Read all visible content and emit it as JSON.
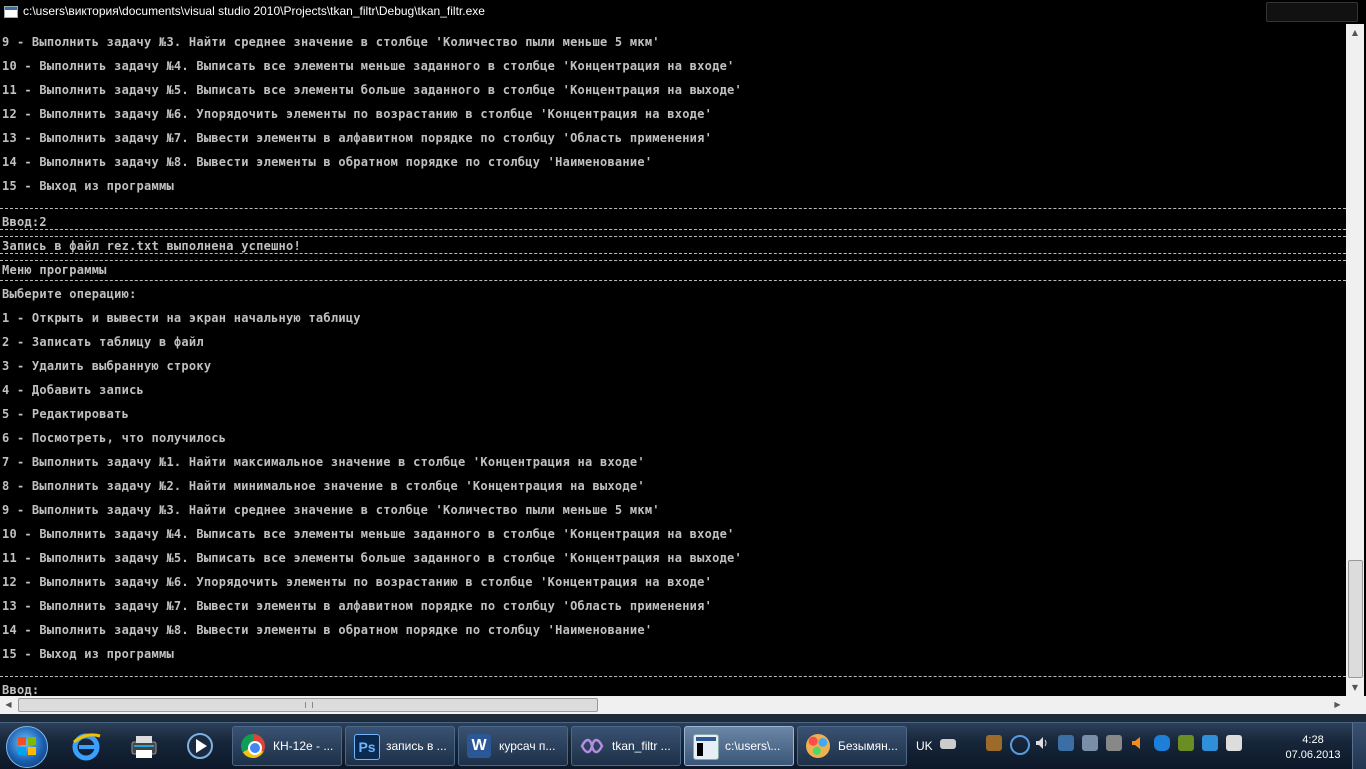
{
  "window": {
    "title": "c:\\users\\виктория\\documents\\visual studio 2010\\Projects\\tkan_filtr\\Debug\\tkan_filtr.exe"
  },
  "console": {
    "lines_top": [
      "9 - Выполнить задачу №3. Найти среднее значение в столбце 'Количество пыли меньше 5 мкм'",
      "10 - Выполнить задачу №4. Выписать все элементы меньше заданного в столбце 'Концентрация на входе'",
      "11 - Выполнить задачу №5. Выписать все элементы больше заданного в столбце 'Концентрация на выходе'",
      "12 - Выполнить задачу №6. Упорядочить элементы по возрастанию в столбце 'Концентрация на входе'",
      "13 - Выполнить задачу №7. Вывести элементы в алфавитном порядке по столбцу 'Область применения'",
      "14 - Выполнить задачу №8. Вывести элементы в обратном порядке по столбцу 'Наименование'",
      "15 - Выход из программы"
    ],
    "input_line": "Ввод:2",
    "success_line": "Запись в файл rez.txt выполнена успешно!",
    "menu_title": "Меню программы",
    "choose_op": "Выберите операцию:",
    "menu_items": [
      "1 - Открыть и вывести на экран начальную таблицу",
      "2 - Записать таблицу в файл",
      "3 - Удалить выбранную строку",
      "4 - Добавить запись",
      "5 - Редактировать",
      "6 - Посмотреть, что получилось",
      "7 - Выполнить задачу №1. Найти максимальное значение в столбце 'Концентрация на входе'",
      "8 - Выполнить задачу №2. Найти минимальное значение в столбце 'Концентрация на выходе'",
      "9 - Выполнить задачу №3. Найти среднее значение в столбце 'Количество пыли меньше 5 мкм'",
      "10 - Выполнить задачу №4. Выписать все элементы меньше заданного в столбце 'Концентрация на входе'",
      "11 - Выполнить задачу №5. Выписать все элементы больше заданного в столбце 'Концентрация на выходе'",
      "12 - Выполнить задачу №6. Упорядочить элементы по возрастанию в столбце 'Концентрация на входе'",
      "13 - Выполнить задачу №7. Вывести элементы в алфавитном порядке по столбцу 'Область применения'",
      "14 - Выполнить задачу №8. Вывести элементы в обратном порядке по столбцу 'Наименование'",
      "15 - Выход из программы"
    ],
    "prompt": "Ввод:"
  },
  "taskbar": {
    "pinned": [
      "internet-explorer-icon",
      "printer-icon",
      "media-player-icon"
    ],
    "tasks": [
      {
        "label": "КН-12е - ...",
        "icon": "chrome-icon",
        "color": "#e8a317"
      },
      {
        "label": "запись в ...",
        "icon": "photoshop-icon",
        "color": "#1c3f7a"
      },
      {
        "label": "курсач п...",
        "icon": "word-icon",
        "color": "#2b5797"
      },
      {
        "label": "tkan_filtr ...",
        "icon": "visual-studio-icon",
        "color": "#68217a"
      },
      {
        "label": "c:\\users\\...",
        "icon": "console-icon",
        "color": "#d8e4f0"
      },
      {
        "label": "Безымян...",
        "icon": "paint-icon",
        "color": "#f2a33a"
      }
    ],
    "language": "UK",
    "time": "4:28",
    "date": "07.06.2013"
  }
}
